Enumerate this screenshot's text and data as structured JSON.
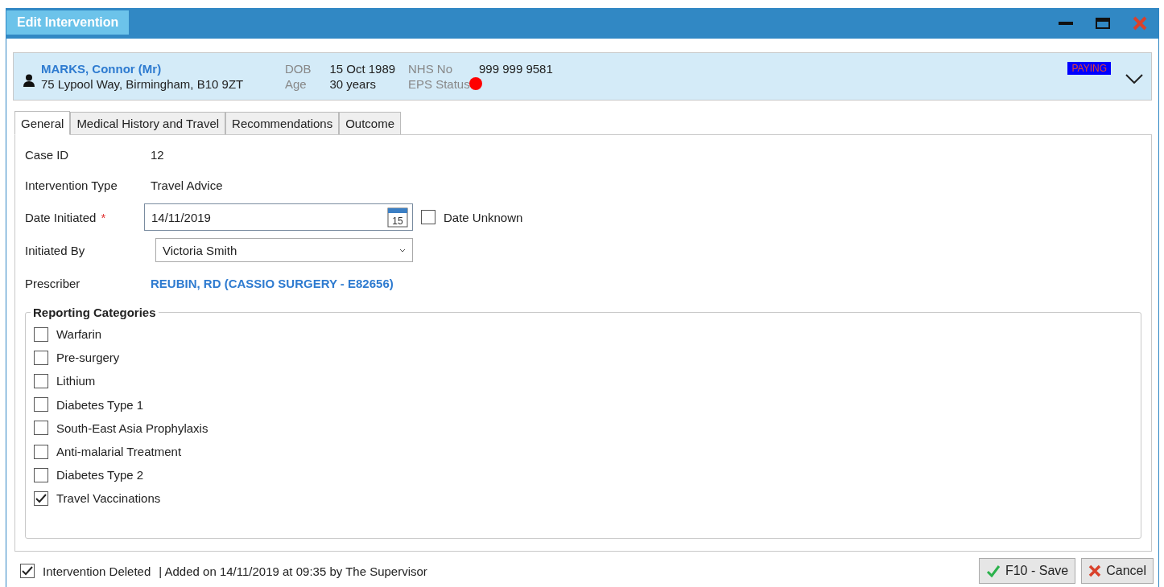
{
  "window": {
    "title": "Edit Intervention"
  },
  "patient": {
    "name": "MARKS, Connor (Mr)",
    "address": "75 Lypool Way, Birmingham, B10 9ZT",
    "dob_label": "DOB",
    "dob": "15 Oct 1989",
    "age_label": "Age",
    "age": "30 years",
    "nhs_label": "NHS No",
    "nhs": "999 999 9581",
    "eps_label": "EPS Status",
    "eps_status": {
      "color": "#ff0000"
    },
    "badge": "PAYING"
  },
  "tabs": [
    {
      "label": "General",
      "selected": true
    },
    {
      "label": "Medical History and Travel",
      "selected": false
    },
    {
      "label": "Recommendations",
      "selected": false
    },
    {
      "label": "Outcome",
      "selected": false
    }
  ],
  "form": {
    "case_id_label": "Case ID",
    "case_id": "12",
    "type_label": "Intervention Type",
    "type": "Travel Advice",
    "date_label": "Date Initiated",
    "required_mark": "*",
    "date": "14/11/2019",
    "calendar_day": "15",
    "date_unknown": {
      "label": "Date Unknown",
      "checked": false
    },
    "initiated_label": "Initiated By",
    "initiated_by": "Victoria Smith",
    "prescriber_label": "Prescriber",
    "prescriber": "REUBIN, RD (CASSIO SURGERY - E82656)"
  },
  "reporting_categories": {
    "title": "Reporting Categories",
    "items": [
      {
        "label": "Warfarin",
        "checked": false
      },
      {
        "label": "Pre-surgery",
        "checked": false
      },
      {
        "label": "Lithium",
        "checked": false
      },
      {
        "label": "Diabetes Type 1",
        "checked": false
      },
      {
        "label": "South-East Asia Prophylaxis",
        "checked": false
      },
      {
        "label": "Anti-malarial Treatment",
        "checked": false
      },
      {
        "label": "Diabetes Type 2",
        "checked": false
      },
      {
        "label": "Travel Vaccinations",
        "checked": true
      }
    ]
  },
  "footer": {
    "deleted": {
      "label": "Intervention Deleted",
      "checked": true
    },
    "info": "| Added on 14/11/2019 at 09:35 by The Supervisor",
    "buttons": [
      {
        "kind": "save",
        "label": "F10 - Save"
      },
      {
        "kind": "cancel",
        "label": "Cancel"
      }
    ]
  }
}
